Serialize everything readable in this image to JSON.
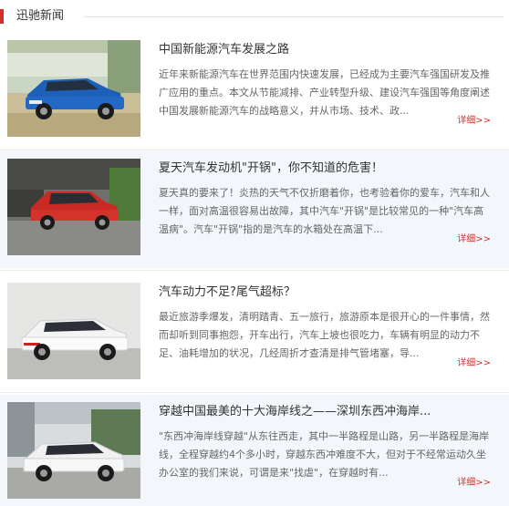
{
  "section": {
    "title": "迅驰新闻"
  },
  "news": [
    {
      "title": "中国新能源汽车发展之路",
      "desc": "近年来新能源汽车在世界范围内快速发展，已经成为主要汽车强国研发及推广应用的重点。本文从节能减排、产业转型升级、建设汽车强国等角度阐述中国发展新能源汽车的战略意义，并从市场、技术、政...",
      "more": "详细>>",
      "image": "blue-suv-photo"
    },
    {
      "title": "夏天汽车发动机\"开锅\"，你不知道的危害！",
      "desc": "夏天真的要来了！炎热的天气不仅折磨着你，也考验着你的爱车，汽车和人一样，面对高温很容易出故障，其中汽车\"开锅\"是比较常见的一种\"汽车高温病\"。汽车\"开锅\"指的是汽车的水箱处在高温下...",
      "more": "详细>>",
      "image": "red-suv-photo"
    },
    {
      "title": "汽车动力不足?尾气超标？",
      "desc": "最近旅游季爆发，清明踏青、五一旅行，旅游原本是很开心的一件事情，然而却听到同事抱怨，开车出行，汽车上坡也很吃力，车辆有明显的动力不足、油耗增加的状况，几经周折才查清是排气管堵塞，导...",
      "more": "详细>>",
      "image": "white-suv-photo"
    },
    {
      "title": "穿越中国最美的十大海岸线之——深圳东西冲海岸...",
      "desc": "\"东西冲海岸线穿越\"从东往西走，其中一半路程是山路，另一半路程是海岸线，全程穿越约4个多小时，穿越东西冲难度不大，但对于不经常运动久坐办公室的我们来说，可谓是来\"找虐\"，在穿越时有...",
      "more": "详细>>",
      "image": "white-suv-street-photo"
    }
  ]
}
